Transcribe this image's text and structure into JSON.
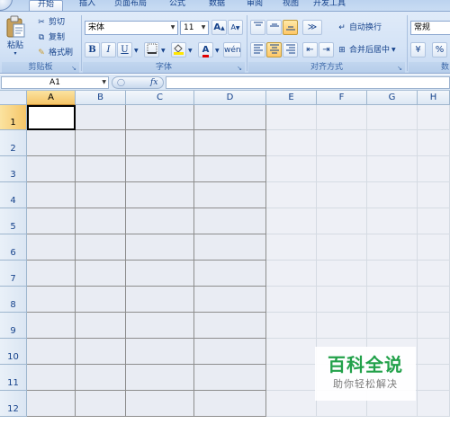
{
  "tabs": [
    {
      "label": "开始",
      "active": true
    },
    {
      "label": "插入",
      "active": false
    },
    {
      "label": "页面布局",
      "active": false
    },
    {
      "label": "公式",
      "active": false
    },
    {
      "label": "数据",
      "active": false
    },
    {
      "label": "审阅",
      "active": false
    },
    {
      "label": "视图",
      "active": false
    },
    {
      "label": "开发工具",
      "active": false
    }
  ],
  "clipboard": {
    "paste": "粘贴",
    "cut": "剪切",
    "copy": "复制",
    "format_painter": "格式刷",
    "title": "剪贴板"
  },
  "font": {
    "name": "宋体",
    "size": "11",
    "grow": "A",
    "shrink": "A",
    "bold": "B",
    "italic": "I",
    "underline": "U",
    "font_color": "A",
    "title": "字体"
  },
  "alignment": {
    "wrap_text": "自动换行",
    "merge_center": "合并后居中",
    "title": "对齐方式"
  },
  "number": {
    "format": "常规",
    "percent": "%",
    "title": "数"
  },
  "formula_bar": {
    "cell_ref": "A1",
    "fx": "fx",
    "value": ""
  },
  "columns": [
    "A",
    "B",
    "C",
    "D",
    "E",
    "F",
    "G",
    "H"
  ],
  "rows": [
    "1",
    "2",
    "3",
    "4",
    "5",
    "6",
    "7",
    "8",
    "9",
    "10",
    "11",
    "12"
  ],
  "watermark": {
    "title": "百科全说",
    "subtitle": "助你轻松解决"
  },
  "colors": {
    "accent": "#15428b",
    "selected_header": "#f5c568",
    "watermark_green": "#22a14a"
  }
}
